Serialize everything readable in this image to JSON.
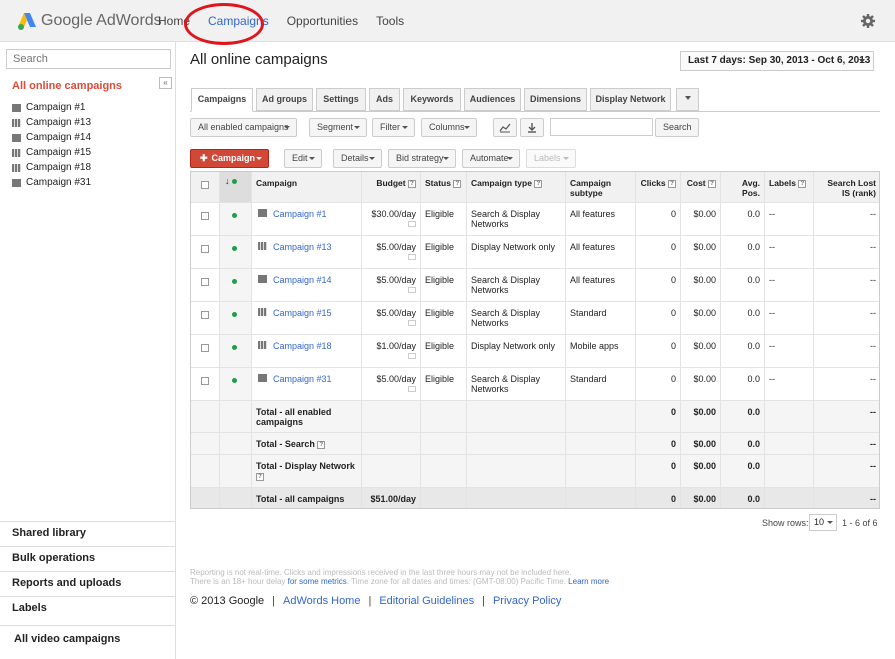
{
  "app": {
    "name": "Google AdWords"
  },
  "nav": {
    "items": [
      "Home",
      "Campaigns",
      "Opportunities",
      "Tools"
    ],
    "active": "Campaigns"
  },
  "sidebar": {
    "search_placeholder": "Search",
    "collapse_label": "«",
    "all_campaigns": "All online campaigns",
    "campaigns": [
      "Campaign #1",
      "Campaign #13",
      "Campaign #14",
      "Campaign #15",
      "Campaign #18",
      "Campaign #31"
    ],
    "sections": [
      "Shared library",
      "Bulk operations",
      "Reports and uploads",
      "Labels",
      "All video campaigns"
    ]
  },
  "main": {
    "title": "All online campaigns",
    "date_range": "Last 7 days: Sep 30, 2013 - Oct 6, 2013",
    "tabs": [
      "Campaigns",
      "Ad groups",
      "Settings",
      "Ads",
      "Keywords",
      "Audiences",
      "Dimensions",
      "Display Network"
    ],
    "toolbar": {
      "filter_select": "All enabled campaigns",
      "segment": "Segment",
      "filter": "Filter",
      "columns": "Columns",
      "search_button": "Search"
    },
    "actions": {
      "new_campaign": "Campaign",
      "edit": "Edit",
      "details": "Details",
      "bid_strategy": "Bid strategy",
      "automate": "Automate",
      "labels": "Labels"
    }
  },
  "table": {
    "headers": {
      "campaign": "Campaign",
      "budget": "Budget",
      "status": "Status",
      "campaign_type": "Campaign type",
      "campaign_subtype": "Campaign subtype",
      "clicks": "Clicks",
      "cost": "Cost",
      "avg_pos": "Avg. Pos.",
      "labels": "Labels",
      "search_lost_is": "Search Lost IS (rank)"
    },
    "rows": [
      {
        "name": "Campaign #1",
        "budget": "$30.00/day",
        "status": "Eligible",
        "type": "Search & Display Networks",
        "subtype": "All features",
        "clicks": "0",
        "cost": "$0.00",
        "pos": "0.0",
        "labels": "--",
        "lost": "--"
      },
      {
        "name": "Campaign #13",
        "budget": "$5.00/day",
        "status": "Eligible",
        "type": "Display Network only",
        "subtype": "All features",
        "clicks": "0",
        "cost": "$0.00",
        "pos": "0.0",
        "labels": "--",
        "lost": "--"
      },
      {
        "name": "Campaign #14",
        "budget": "$5.00/day",
        "status": "Eligible",
        "type": "Search & Display Networks",
        "subtype": "All features",
        "clicks": "0",
        "cost": "$0.00",
        "pos": "0.0",
        "labels": "--",
        "lost": "--"
      },
      {
        "name": "Campaign #15",
        "budget": "$5.00/day",
        "status": "Eligible",
        "type": "Search & Display Networks",
        "subtype": "Standard",
        "clicks": "0",
        "cost": "$0.00",
        "pos": "0.0",
        "labels": "--",
        "lost": "--"
      },
      {
        "name": "Campaign #18",
        "budget": "$1.00/day",
        "status": "Eligible",
        "type": "Display Network only",
        "subtype": "Mobile apps",
        "clicks": "0",
        "cost": "$0.00",
        "pos": "0.0",
        "labels": "--",
        "lost": "--"
      },
      {
        "name": "Campaign #31",
        "budget": "$5.00/day",
        "status": "Eligible",
        "type": "Search & Display Networks",
        "subtype": "Standard",
        "clicks": "0",
        "cost": "$0.00",
        "pos": "0.0",
        "labels": "--",
        "lost": "--"
      }
    ],
    "totals": [
      {
        "label": "Total - all enabled campaigns",
        "budget": "",
        "clicks": "0",
        "cost": "$0.00",
        "pos": "0.0",
        "lost": "--"
      },
      {
        "label": "Total - Search",
        "budget": "",
        "clicks": "0",
        "cost": "$0.00",
        "pos": "0.0",
        "lost": "--"
      },
      {
        "label": "Total - Display Network",
        "budget": "",
        "clicks": "0",
        "cost": "$0.00",
        "pos": "0.0",
        "lost": "--"
      },
      {
        "label": "Total - all campaigns",
        "budget": "$51.00/day",
        "clicks": "0",
        "cost": "$0.00",
        "pos": "0.0",
        "lost": "--"
      }
    ]
  },
  "pagination": {
    "show_rows_label": "Show rows:",
    "rows_value": "10",
    "range": "1 - 6 of 6"
  },
  "notes": {
    "line1": "Reporting is not real-time. Clicks and impressions received in the last three hours may not be included here.",
    "line2_pre": "There is an 18+ hour delay ",
    "line2_link": "for some metrics",
    "line2_mid": ". Time zone for all dates and times: (GMT-08:00) Pacific Time. ",
    "line2_link2": "Learn more"
  },
  "footer": {
    "copyright": "© 2013 Google",
    "links": [
      "AdWords Home",
      "Editorial Guidelines",
      "Privacy Policy"
    ]
  },
  "colors": {
    "accent": "#3366cc",
    "red": "#dd4b39",
    "status_green": "#1e9e4a"
  }
}
